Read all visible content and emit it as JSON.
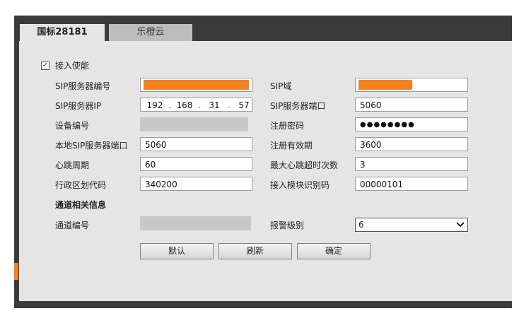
{
  "tabs": [
    {
      "label": "国标28181"
    },
    {
      "label": "乐橙云"
    }
  ],
  "enable": {
    "label": "接入使能",
    "checked": true,
    "mark": "✓"
  },
  "fields": {
    "sip_server_id": {
      "label": "SIP服务器编号"
    },
    "sip_domain": {
      "label": "SIP域"
    },
    "sip_server_ip": {
      "label": "SIP服务器IP",
      "octets": [
        "192",
        "168",
        "31",
        "57"
      ]
    },
    "sip_server_port": {
      "label": "SIP服务器端口",
      "value": "5060"
    },
    "device_id": {
      "label": "设备编号"
    },
    "register_password": {
      "label": "注册密码",
      "value": "●●●●●●●●"
    },
    "local_sip_port": {
      "label": "本地SIP服务器端口",
      "value": "5060"
    },
    "register_validity": {
      "label": "注册有效期",
      "value": "3600"
    },
    "heartbeat_period": {
      "label": "心跳周期",
      "value": "60"
    },
    "max_heartbeat_timeouts": {
      "label": "最大心跳超时次数",
      "value": "3"
    },
    "region_code": {
      "label": "行政区划代码",
      "value": "340200"
    },
    "access_module_id": {
      "label": "接入模块识别码",
      "value": "00000101"
    }
  },
  "channel": {
    "title": "通道相关信息",
    "channel_id": {
      "label": "通道编号"
    },
    "alarm_level": {
      "label": "报警级别",
      "value": "6"
    }
  },
  "buttons": {
    "default": "默认",
    "refresh": "刷新",
    "confirm": "确定"
  },
  "colors": {
    "accent": "#f58220",
    "panel": "#e5e5e5",
    "frame": "#3b3b3b"
  }
}
